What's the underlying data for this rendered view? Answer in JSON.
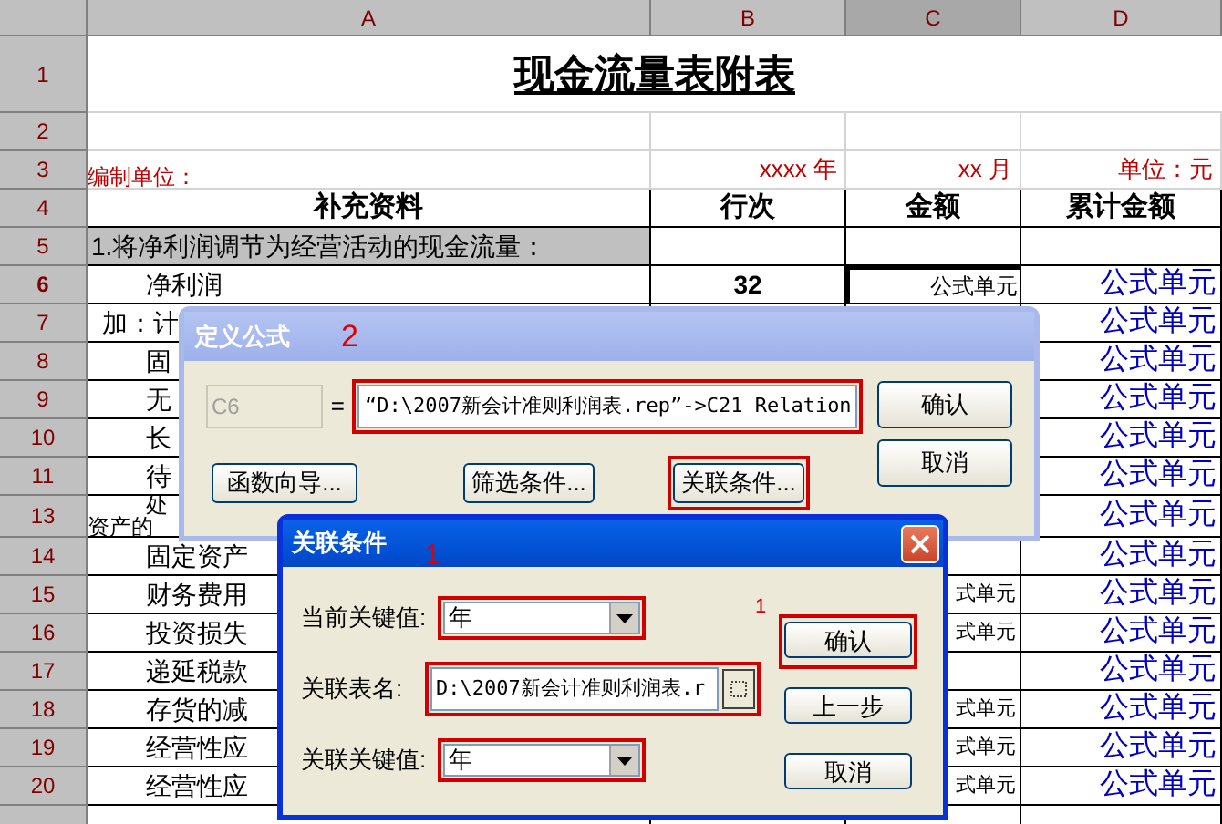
{
  "columns": [
    {
      "label": "A",
      "selected": false
    },
    {
      "label": "B",
      "selected": false
    },
    {
      "label": "C",
      "selected": true
    },
    {
      "label": "D",
      "selected": false
    }
  ],
  "rows": [
    {
      "number": "1",
      "kind": "title",
      "selected": false,
      "title": "现金流量表附表"
    },
    {
      "number": "2",
      "kind": "blank",
      "selected": false
    },
    {
      "number": "3",
      "kind": "meta",
      "selected": false,
      "a": "编制单位：",
      "b": "xxxx 年",
      "c": "xx 月",
      "d": "单位：元"
    },
    {
      "number": "4",
      "kind": "header",
      "selected": false,
      "a": "补充资料",
      "b": "行次",
      "c": "金额",
      "d": "累计金额"
    },
    {
      "number": "5",
      "kind": "section",
      "selected": false,
      "a": "1.将净利润调节为经营活动的现金流量："
    },
    {
      "number": "6",
      "kind": "item",
      "selected": true,
      "a": "净利润",
      "b": "32",
      "c": "公式单元",
      "d": "公式单元"
    },
    {
      "number": "7",
      "kind": "group",
      "selected": false,
      "a": "加：计",
      "d": "公式单元"
    },
    {
      "number": "8",
      "kind": "item",
      "selected": false,
      "a": "固",
      "d": "公式单元"
    },
    {
      "number": "9",
      "kind": "item",
      "selected": false,
      "a": "无",
      "d": "公式单元"
    },
    {
      "number": "10",
      "kind": "item",
      "selected": false,
      "a": "长",
      "d": "公式单元"
    },
    {
      "number": "11",
      "kind": "item",
      "selected": false,
      "a": "待",
      "d": "公式单元"
    },
    {
      "number": "13",
      "kind": "wrapped",
      "selected": false,
      "a": "处",
      "a2": "资产的",
      "d": "公式单元"
    },
    {
      "number": "14",
      "kind": "item",
      "selected": false,
      "a": "固定资产",
      "d": "公式单元"
    },
    {
      "number": "15",
      "kind": "item",
      "selected": false,
      "a": "财务费用",
      "c": "式单元",
      "d": "公式单元"
    },
    {
      "number": "16",
      "kind": "item",
      "selected": false,
      "a": "投资损失",
      "c": "式单元",
      "d": "公式单元"
    },
    {
      "number": "17",
      "kind": "item",
      "selected": false,
      "a": "递延税款",
      "d": "公式单元"
    },
    {
      "number": "18",
      "kind": "item",
      "selected": false,
      "a": "存货的减",
      "c": "式单元",
      "d": "公式单元"
    },
    {
      "number": "19",
      "kind": "item",
      "selected": false,
      "a": "经营性应",
      "c": "式单元",
      "d": "公式单元"
    },
    {
      "number": "20",
      "kind": "item",
      "selected": false,
      "a": "经营性应",
      "c": "式单元",
      "d": "公式单元"
    }
  ],
  "formula_dialog": {
    "title": "定义公式",
    "annotation": "2",
    "cell_ref": "C6",
    "equals": "=",
    "formula": "“D:\\2007新会计准则利润表.rep”->C21 Relation",
    "formula_highlighted": true,
    "buttons": [
      {
        "label": "确认"
      },
      {
        "label": "取消"
      }
    ],
    "bottom_buttons": [
      {
        "label": "函数向导...",
        "highlighted": false
      },
      {
        "label": "筛选条件...",
        "highlighted": false
      },
      {
        "label": "关联条件...",
        "highlighted": true
      }
    ]
  },
  "relation_dialog": {
    "title": "关联条件",
    "annotations": [
      "1",
      "1"
    ],
    "fields": [
      {
        "kind": "combo",
        "label": "当前关键值:",
        "value": "年",
        "highlighted": true
      },
      {
        "kind": "file",
        "label": "关联表名:",
        "value": "D:\\2007新会计准则利润表.r",
        "highlighted": true
      },
      {
        "kind": "combo",
        "label": "关联关键值:",
        "value": "年",
        "highlighted": true
      }
    ],
    "buttons": [
      {
        "label": "确认",
        "highlighted": true
      },
      {
        "label": "上一步",
        "highlighted": false
      },
      {
        "label": "取消",
        "highlighted": false
      }
    ]
  }
}
